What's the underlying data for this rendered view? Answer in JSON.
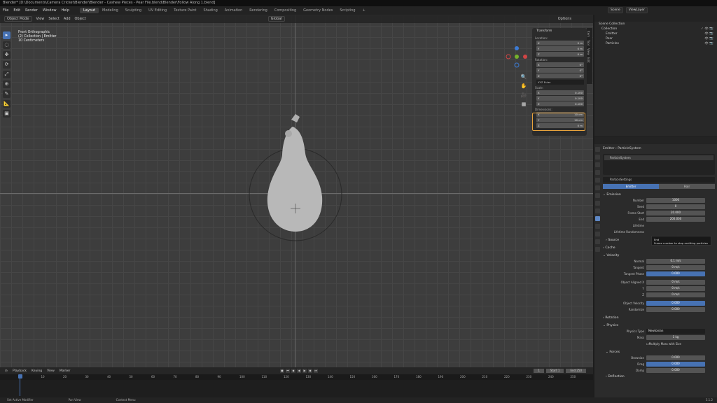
{
  "window": {
    "title": "Blender* [D:\\Documents\\Camera Cricket\\Blender\\Blender - Cashew Pieces - Pear File.blend\\Blender\\Follow Along 1.blend]"
  },
  "menu": [
    "File",
    "Edit",
    "Render",
    "Window",
    "Help"
  ],
  "workspaces": [
    "Layout",
    "Modeling",
    "Sculpting",
    "UV Editing",
    "Texture Paint",
    "Shading",
    "Animation",
    "Rendering",
    "Compositing",
    "Geometry Nodes",
    "Scripting",
    "+"
  ],
  "scene": {
    "name": "Scene",
    "view_layer": "ViewLayer"
  },
  "viewport": {
    "header": {
      "mode": "Object Mode",
      "view": "View",
      "select": "Select",
      "add": "Add",
      "object": "Object",
      "orientation": "Global",
      "options": "Options"
    },
    "overlay": {
      "line1": "Front Orthographic",
      "line2": "(2) Collection | Emitter",
      "line3": "10 Centimeters"
    },
    "tools": [
      "▸",
      "◌",
      "✥",
      "⟳",
      "⤢",
      "⊕",
      "✎",
      "📐",
      "▣"
    ]
  },
  "npanel": {
    "tab_header": "Transform",
    "location_label": "Location:",
    "location": [
      {
        "axis": "X",
        "value": "0 m"
      },
      {
        "axis": "Y",
        "value": "0 m"
      },
      {
        "axis": "Z",
        "value": "0 m"
      }
    ],
    "rotation_label": "Rotation:",
    "rotation": [
      {
        "axis": "X",
        "value": "0°"
      },
      {
        "axis": "Y",
        "value": "0°"
      },
      {
        "axis": "Z",
        "value": "0°"
      }
    ],
    "rotation_mode": "XYZ Euler",
    "scale_label": "Scale:",
    "scale": [
      {
        "axis": "X",
        "value": "0.100"
      },
      {
        "axis": "Y",
        "value": "0.100"
      },
      {
        "axis": "Z",
        "value": "0.100"
      }
    ],
    "dimensions_label": "Dimensions:",
    "dimensions": [
      {
        "axis": "X",
        "value": "10 cm"
      },
      {
        "axis": "Y",
        "value": "10 cm"
      },
      {
        "axis": "Z",
        "value": "0 m"
      }
    ],
    "tabs": [
      "Item",
      "Tool",
      "View",
      "Edit"
    ]
  },
  "outliner": {
    "rows": [
      {
        "label": "Scene Collection",
        "vis": ""
      },
      {
        "label": "Collection",
        "vis": "✓ 👁 📷"
      },
      {
        "label": "Emitter",
        "vis": "👁 📷"
      },
      {
        "label": "Pear",
        "vis": "👁 📷"
      },
      {
        "label": "Particles",
        "vis": "👁 📷"
      }
    ]
  },
  "properties": {
    "breadcrumb": "Emitter  ›  ParticleSystem",
    "list_item": "ParticleSystem",
    "settings_name": "ParticleSettings",
    "type_tabs": [
      {
        "label": "Emitter",
        "on": true
      },
      {
        "label": "Hair",
        "on": false
      }
    ],
    "emission": {
      "title": "Emission",
      "rows": [
        {
          "label": "Number",
          "value": "1000"
        },
        {
          "label": "Seed",
          "value": "0"
        },
        {
          "label": "Frame Start",
          "value": "20.000"
        },
        {
          "label": "End",
          "value": "200.000"
        },
        {
          "label": "Lifetime",
          "value": ""
        },
        {
          "label": "Lifetime Randomness",
          "value": ""
        }
      ]
    },
    "tooltip": {
      "title": "End",
      "body": "Frame number to stop emitting particles"
    },
    "source_title": "Source",
    "cache_title": "Cache",
    "velocity": {
      "title": "Velocity",
      "rows": [
        {
          "label": "Normal",
          "value": "0.1 m/s",
          "blue": false
        },
        {
          "label": "Tangent",
          "value": "0 m/s",
          "blue": false
        },
        {
          "label": "Tangent Phase",
          "value": "0.000",
          "blue": true
        },
        {
          "label": "Object Aligned X",
          "value": "0 m/s",
          "blue": false
        },
        {
          "label": "Y",
          "value": "0 m/s",
          "blue": false
        },
        {
          "label": "Z",
          "value": "0 m/s",
          "blue": false
        },
        {
          "label": "Object Velocity",
          "value": "0.000",
          "blue": true
        },
        {
          "label": "Randomize",
          "value": "0.000",
          "blue": false
        }
      ]
    },
    "rotation_title": "Rotation",
    "physics": {
      "title": "Physics",
      "type_label": "Physics Type",
      "type_value": "Newtonian",
      "mass_label": "Mass",
      "mass_value": "1 kg",
      "multiply_label": "Multiply Mass with Size"
    },
    "forces": {
      "title": "Forces",
      "rows": [
        {
          "label": "Brownian",
          "value": "0.000",
          "blue": false
        },
        {
          "label": "Drag",
          "value": "0.000",
          "blue": true
        },
        {
          "label": "Damp",
          "value": "0.000",
          "blue": false
        }
      ]
    },
    "deflection_title": "Deflection"
  },
  "timeline": {
    "menus": [
      "Playback",
      "Keying",
      "View",
      "Marker"
    ],
    "current_frame": "1",
    "start_label": "Start",
    "start": "1",
    "end_label": "End",
    "end": "250",
    "ticks": [
      "0",
      "10",
      "20",
      "30",
      "40",
      "50",
      "60",
      "70",
      "80",
      "90",
      "100",
      "110",
      "120",
      "130",
      "140",
      "150",
      "160",
      "170",
      "180",
      "190",
      "200",
      "210",
      "220",
      "230",
      "240",
      "250"
    ]
  },
  "status": {
    "left": "Set Active Modifier",
    "middle": "Pan View",
    "right": "Context Menu",
    "version": "3.1.2"
  }
}
